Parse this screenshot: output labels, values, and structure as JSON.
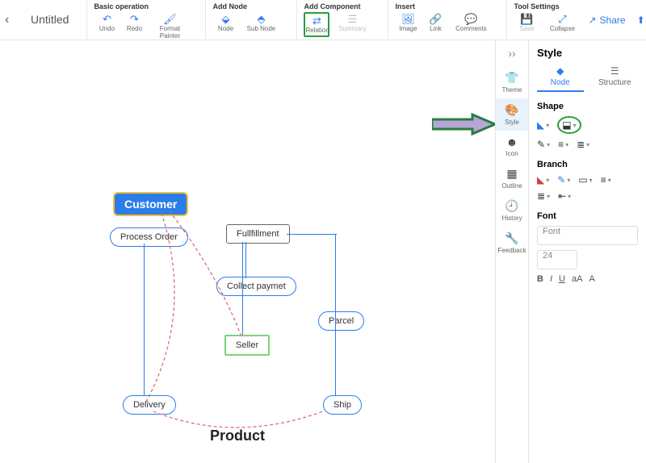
{
  "document": {
    "title": "Untitled"
  },
  "toolbar": {
    "groups": {
      "basic": {
        "label": "Basic operation",
        "undo": "Undo",
        "redo": "Redo",
        "format": "Format Painter"
      },
      "addnode": {
        "label": "Add Node",
        "node": "Node",
        "subnode": "Sub Node"
      },
      "addcomp": {
        "label": "Add Component",
        "relation": "Relation",
        "summary": "Summary"
      },
      "insert": {
        "label": "Insert",
        "image": "Image",
        "link": "Link",
        "comments": "Comments"
      },
      "tools": {
        "label": "Tool Settings",
        "save": "Save",
        "collapse": "Collapse"
      }
    },
    "share": "Share",
    "export": "Export"
  },
  "vside": {
    "theme": "Theme",
    "style": "Style",
    "icon": "Icon",
    "outline": "Outline",
    "history": "History",
    "feedback": "Feedback"
  },
  "rpanel": {
    "title": "Style",
    "tab_node": "Node",
    "tab_structure": "Structure",
    "shape": "Shape",
    "branch": "Branch",
    "font": "Font",
    "font_sel": "Font",
    "size": "24",
    "bold": "B",
    "italic": "I",
    "underline": "U",
    "case": "aA",
    "color": "A"
  },
  "nodes": {
    "customer": "Customer",
    "process": "Process Order",
    "fulfillment": "Fullfillment",
    "collect": "Collect paymet",
    "seller": "Seller",
    "parcel": "Parcel",
    "delivery": "Delivery",
    "ship": "Ship",
    "product": "Product"
  }
}
